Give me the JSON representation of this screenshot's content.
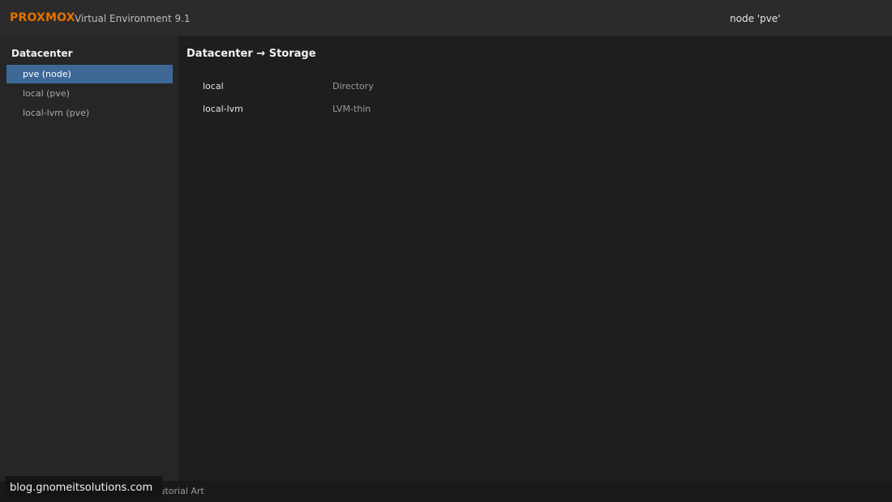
{
  "header": {
    "brand": "PROXMOX",
    "version": "Virtual Environment 9.1",
    "node_indicator": "node 'pve'"
  },
  "sidebar": {
    "title": "Datacenter",
    "items": [
      {
        "label": "pve (node)",
        "selected": true
      },
      {
        "label": "local (pve)",
        "selected": false
      },
      {
        "label": "local-lvm (pve)",
        "selected": false
      }
    ]
  },
  "main": {
    "title": "Datacenter → Storage",
    "storage": [
      {
        "name": "local",
        "type": "Directory"
      },
      {
        "name": "local-lvm",
        "type": "LVM-thin"
      }
    ]
  },
  "footer": {
    "text": "Datacenter tree • Proxmox VE • Tutorial Art"
  },
  "watermark": {
    "text": "blog.gnomeitsolutions.com"
  },
  "colors": {
    "brand": "#e57000",
    "selection": "#3e6896",
    "background": "#1e1e1e"
  }
}
